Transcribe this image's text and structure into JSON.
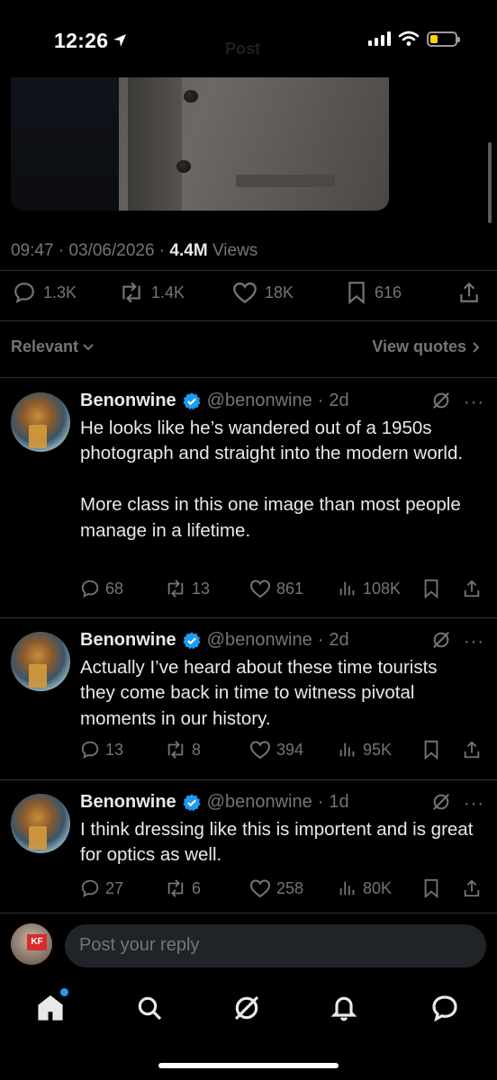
{
  "status_bar": {
    "time": "12:26",
    "battery_level": 0.3,
    "battery_color": "#ffd60a",
    "faded_title": "Post"
  },
  "post": {
    "time": "09:47",
    "date": "03/06/2026",
    "views_count": "4.4M",
    "views_label": "Views",
    "replies": "1.3K",
    "reposts": "1.4K",
    "likes": "18K",
    "bookmarks": "616"
  },
  "sort": {
    "label": "Relevant",
    "view_quotes": "View quotes"
  },
  "replies": [
    {
      "name": "Benonwine",
      "handle": "@benonwine",
      "age": "2d",
      "text": "He looks like he’s wandered out of a 1950s photograph and straight into the modern world.\n\nMore class in this one image than most people manage in a lifetime.",
      "replies": "68",
      "reposts": "13",
      "likes": "861",
      "views": "108K"
    },
    {
      "name": "Benonwine",
      "handle": "@benonwine",
      "age": "2d",
      "text": "Actually I’ve heard about these time tourists they come back in time to witness pivotal moments in our history.",
      "replies": "13",
      "reposts": "8",
      "likes": "394",
      "views": "95K"
    },
    {
      "name": "Benonwine",
      "handle": "@benonwine",
      "age": "1d",
      "text": "I think dressing like this is importent and is great for optics as well.",
      "replies": "27",
      "reposts": "6",
      "likes": "258",
      "views": "80K"
    }
  ],
  "composer": {
    "placeholder": "Post your reply",
    "avatar_text": "KF"
  },
  "tabs": [
    "home-icon",
    "search-icon",
    "grok-icon",
    "notifications-icon",
    "messages-icon"
  ],
  "colors": {
    "background": "#000000",
    "text": "#e7e9ea",
    "muted": "#71767b",
    "accent": "#1d9bf0",
    "divider": "#2f3336"
  }
}
